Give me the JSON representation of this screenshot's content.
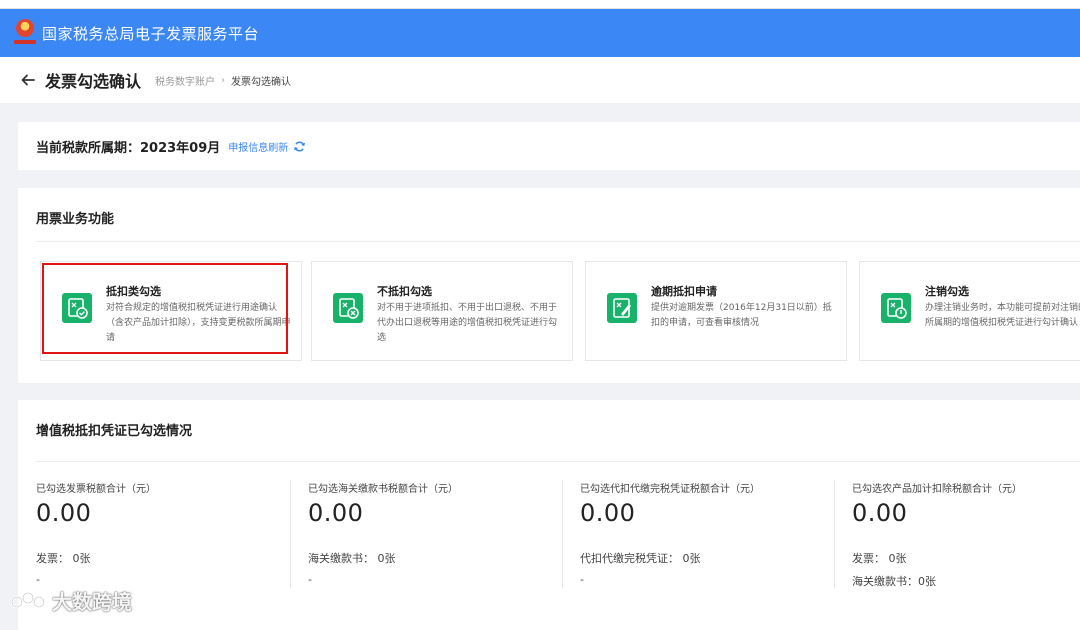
{
  "app": {
    "platform_title": "国家税务总局电子发票服务平台"
  },
  "titlebar": {
    "title": "发票勾选确认",
    "breadcrumb": [
      "税务数字账户",
      "发票勾选确认"
    ]
  },
  "period": {
    "label": "当前税款所属期：2023年09月",
    "refresh_link": "申报信息刷新"
  },
  "functions": {
    "title": "用票业务功能",
    "items": [
      {
        "name": "抵扣类勾选",
        "desc": "对符合规定的增值税扣税凭证进行用途确认（含农产品加计扣除），支持变更税款所属期申请",
        "icon": "deduct-check-icon"
      },
      {
        "name": "不抵扣勾选",
        "desc": "对不用于进项抵扣、不用于出口退税、不用于代办出口退税等用途的增值税扣税凭证进行勾选",
        "icon": "no-deduct-icon"
      },
      {
        "name": "逾期抵扣申请",
        "desc": "提供对逾期发票（2016年12月31日以前）抵扣的申请，可查看审核情况",
        "icon": "overdue-edit-icon"
      },
      {
        "name": "注销勾选",
        "desc": "办理注销业务时，本功能可提前对注销的税款所属期的增值税扣税凭证进行勾计确认",
        "icon": "cancel-power-icon"
      }
    ]
  },
  "summary": {
    "title": "增值税抵扣凭证已勾选情况",
    "stats": [
      {
        "label": "已勾选发票税额合计（元）",
        "value": "0.00",
        "line1": "发票：  0张",
        "line2": "-"
      },
      {
        "label": "已勾选海关缴款书税额合计（元）",
        "value": "0.00",
        "line1": "海关缴款书：  0张",
        "line2": "-"
      },
      {
        "label": "已勾选代扣代缴完税凭证税额合计（元）",
        "value": "0.00",
        "line1": "代扣代缴完税凭证：  0张",
        "line2": "-"
      },
      {
        "label": "已勾选农产品加计扣除税额合计（元）",
        "value": "0.00",
        "line1": "发票：  0张",
        "line2": "海关缴款书：0张"
      }
    ]
  },
  "watermark": {
    "text": "大数跨境"
  },
  "colors": {
    "header_blue": "#3b87f5",
    "icon_green": "#19b26b",
    "highlight_red": "#e01414"
  }
}
